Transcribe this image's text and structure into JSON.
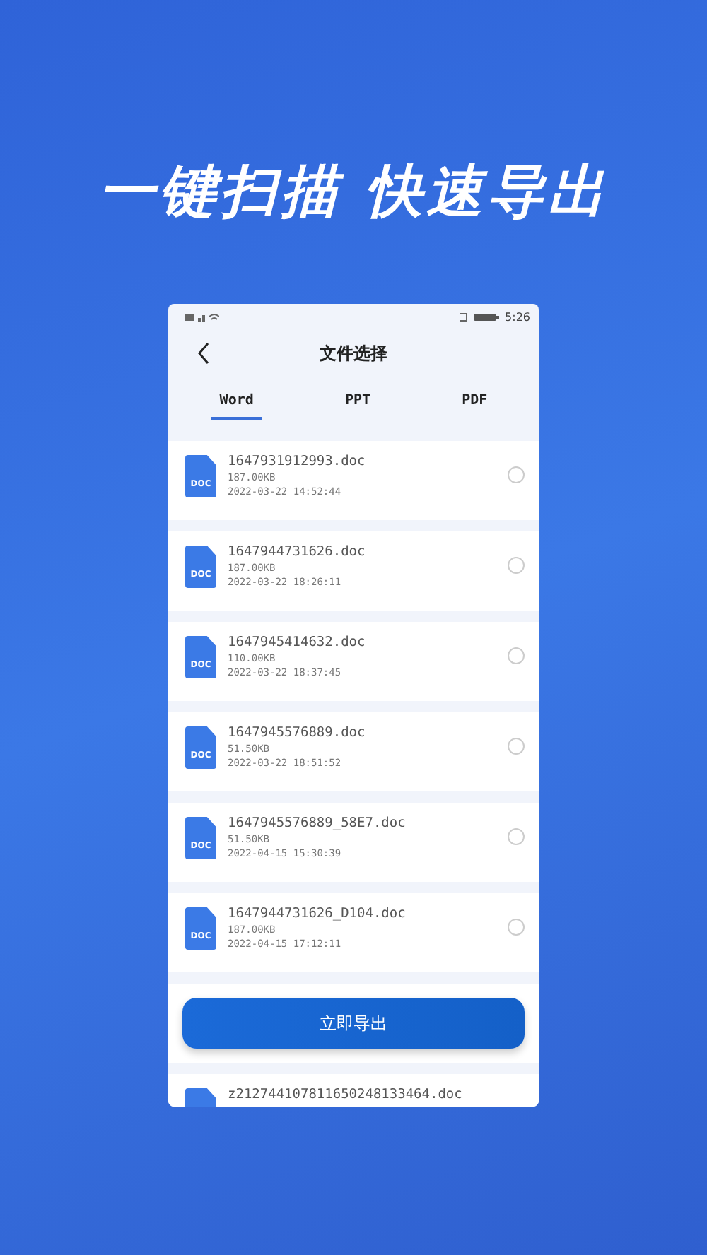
{
  "headline": "一键扫描 快速导出",
  "status_bar": {
    "time": "5:26"
  },
  "header": {
    "title": "文件选择"
  },
  "tabs": [
    {
      "label": "Word",
      "selected": true
    },
    {
      "label": "PPT",
      "selected": false
    },
    {
      "label": "PDF",
      "selected": false
    }
  ],
  "files": [
    {
      "icon_label": "DOC",
      "name": "1647931912993.doc",
      "size": "187.00KB",
      "date": "2022-03-22 14:52:44",
      "selected": false
    },
    {
      "icon_label": "DOC",
      "name": "1647944731626.doc",
      "size": "187.00KB",
      "date": "2022-03-22 18:26:11",
      "selected": false
    },
    {
      "icon_label": "DOC",
      "name": "1647945414632.doc",
      "size": "110.00KB",
      "date": "2022-03-22 18:37:45",
      "selected": false
    },
    {
      "icon_label": "DOC",
      "name": "1647945576889.doc",
      "size": "51.50KB",
      "date": "2022-03-22 18:51:52",
      "selected": false
    },
    {
      "icon_label": "DOC",
      "name": "1647945576889_58E7.doc",
      "size": "51.50KB",
      "date": "2022-04-15 15:30:39",
      "selected": false
    },
    {
      "icon_label": "DOC",
      "name": "1647944731626_D104.doc",
      "size": "187.00KB",
      "date": "2022-04-15 17:12:11",
      "selected": false
    }
  ],
  "export_button": {
    "label": "立即导出"
  },
  "more_files": [
    {
      "name": "z212744107811650248133464.doc"
    }
  ]
}
